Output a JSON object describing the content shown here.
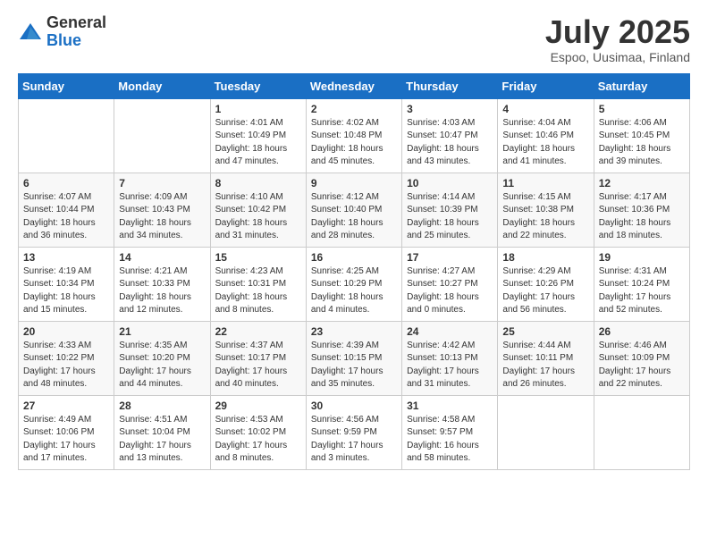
{
  "header": {
    "logo_general": "General",
    "logo_blue": "Blue",
    "month_title": "July 2025",
    "location": "Espoo, Uusimaa, Finland"
  },
  "days_of_week": [
    "Sunday",
    "Monday",
    "Tuesday",
    "Wednesday",
    "Thursday",
    "Friday",
    "Saturday"
  ],
  "weeks": [
    [
      {
        "day": "",
        "info": ""
      },
      {
        "day": "",
        "info": ""
      },
      {
        "day": "1",
        "info": "Sunrise: 4:01 AM\nSunset: 10:49 PM\nDaylight: 18 hours and 47 minutes."
      },
      {
        "day": "2",
        "info": "Sunrise: 4:02 AM\nSunset: 10:48 PM\nDaylight: 18 hours and 45 minutes."
      },
      {
        "day": "3",
        "info": "Sunrise: 4:03 AM\nSunset: 10:47 PM\nDaylight: 18 hours and 43 minutes."
      },
      {
        "day": "4",
        "info": "Sunrise: 4:04 AM\nSunset: 10:46 PM\nDaylight: 18 hours and 41 minutes."
      },
      {
        "day": "5",
        "info": "Sunrise: 4:06 AM\nSunset: 10:45 PM\nDaylight: 18 hours and 39 minutes."
      }
    ],
    [
      {
        "day": "6",
        "info": "Sunrise: 4:07 AM\nSunset: 10:44 PM\nDaylight: 18 hours and 36 minutes."
      },
      {
        "day": "7",
        "info": "Sunrise: 4:09 AM\nSunset: 10:43 PM\nDaylight: 18 hours and 34 minutes."
      },
      {
        "day": "8",
        "info": "Sunrise: 4:10 AM\nSunset: 10:42 PM\nDaylight: 18 hours and 31 minutes."
      },
      {
        "day": "9",
        "info": "Sunrise: 4:12 AM\nSunset: 10:40 PM\nDaylight: 18 hours and 28 minutes."
      },
      {
        "day": "10",
        "info": "Sunrise: 4:14 AM\nSunset: 10:39 PM\nDaylight: 18 hours and 25 minutes."
      },
      {
        "day": "11",
        "info": "Sunrise: 4:15 AM\nSunset: 10:38 PM\nDaylight: 18 hours and 22 minutes."
      },
      {
        "day": "12",
        "info": "Sunrise: 4:17 AM\nSunset: 10:36 PM\nDaylight: 18 hours and 18 minutes."
      }
    ],
    [
      {
        "day": "13",
        "info": "Sunrise: 4:19 AM\nSunset: 10:34 PM\nDaylight: 18 hours and 15 minutes."
      },
      {
        "day": "14",
        "info": "Sunrise: 4:21 AM\nSunset: 10:33 PM\nDaylight: 18 hours and 12 minutes."
      },
      {
        "day": "15",
        "info": "Sunrise: 4:23 AM\nSunset: 10:31 PM\nDaylight: 18 hours and 8 minutes."
      },
      {
        "day": "16",
        "info": "Sunrise: 4:25 AM\nSunset: 10:29 PM\nDaylight: 18 hours and 4 minutes."
      },
      {
        "day": "17",
        "info": "Sunrise: 4:27 AM\nSunset: 10:27 PM\nDaylight: 18 hours and 0 minutes."
      },
      {
        "day": "18",
        "info": "Sunrise: 4:29 AM\nSunset: 10:26 PM\nDaylight: 17 hours and 56 minutes."
      },
      {
        "day": "19",
        "info": "Sunrise: 4:31 AM\nSunset: 10:24 PM\nDaylight: 17 hours and 52 minutes."
      }
    ],
    [
      {
        "day": "20",
        "info": "Sunrise: 4:33 AM\nSunset: 10:22 PM\nDaylight: 17 hours and 48 minutes."
      },
      {
        "day": "21",
        "info": "Sunrise: 4:35 AM\nSunset: 10:20 PM\nDaylight: 17 hours and 44 minutes."
      },
      {
        "day": "22",
        "info": "Sunrise: 4:37 AM\nSunset: 10:17 PM\nDaylight: 17 hours and 40 minutes."
      },
      {
        "day": "23",
        "info": "Sunrise: 4:39 AM\nSunset: 10:15 PM\nDaylight: 17 hours and 35 minutes."
      },
      {
        "day": "24",
        "info": "Sunrise: 4:42 AM\nSunset: 10:13 PM\nDaylight: 17 hours and 31 minutes."
      },
      {
        "day": "25",
        "info": "Sunrise: 4:44 AM\nSunset: 10:11 PM\nDaylight: 17 hours and 26 minutes."
      },
      {
        "day": "26",
        "info": "Sunrise: 4:46 AM\nSunset: 10:09 PM\nDaylight: 17 hours and 22 minutes."
      }
    ],
    [
      {
        "day": "27",
        "info": "Sunrise: 4:49 AM\nSunset: 10:06 PM\nDaylight: 17 hours and 17 minutes."
      },
      {
        "day": "28",
        "info": "Sunrise: 4:51 AM\nSunset: 10:04 PM\nDaylight: 17 hours and 13 minutes."
      },
      {
        "day": "29",
        "info": "Sunrise: 4:53 AM\nSunset: 10:02 PM\nDaylight: 17 hours and 8 minutes."
      },
      {
        "day": "30",
        "info": "Sunrise: 4:56 AM\nSunset: 9:59 PM\nDaylight: 17 hours and 3 minutes."
      },
      {
        "day": "31",
        "info": "Sunrise: 4:58 AM\nSunset: 9:57 PM\nDaylight: 16 hours and 58 minutes."
      },
      {
        "day": "",
        "info": ""
      },
      {
        "day": "",
        "info": ""
      }
    ]
  ]
}
